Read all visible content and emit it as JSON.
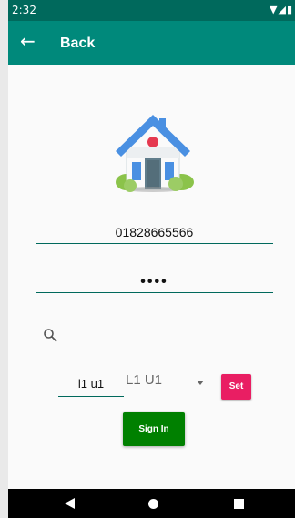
{
  "status_bar": {
    "time": "2:32",
    "icons": "wifi-icon signal-icon battery-icon"
  },
  "app_bar": {
    "title": "Back"
  },
  "form": {
    "phone": "01828665566",
    "password_mask": "••••",
    "small_input_value": "l1 u1",
    "spinner_value": "L1 U1",
    "set_label": "Set",
    "signin_label": "Sign In"
  },
  "colors": {
    "primary": "#00897b",
    "primary_dark": "#00695c",
    "set_button": "#e91e63",
    "signin_button": "#008000"
  }
}
